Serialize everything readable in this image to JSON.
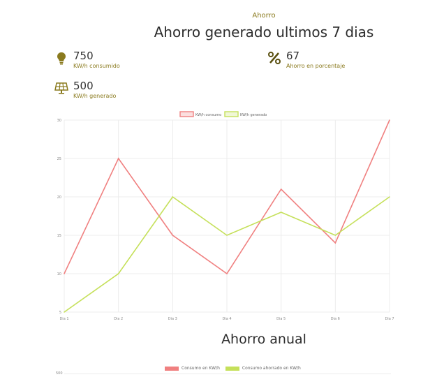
{
  "header": {
    "eyebrow": "Ahorro",
    "title": "Ahorro generado ultimos 7 dias"
  },
  "stats": {
    "consumed": {
      "value": "750",
      "label": "KW/h consumido",
      "icon": "lightbulb-icon"
    },
    "percent": {
      "value": "67",
      "label": "Ahorro en porcentaje",
      "icon": "percent-icon"
    },
    "generated": {
      "value": "500",
      "label": "KW/h generado",
      "icon": "solar-panel-icon"
    }
  },
  "colors": {
    "accent": "#8a7a1e",
    "consumo": "#f08080",
    "generado": "#c5e05a"
  },
  "chart_data": [
    {
      "type": "line",
      "categories": [
        "Dia 1",
        "Dia 2",
        "Dia 3",
        "Dia 4",
        "Dia 5",
        "Dia 6",
        "Dia 7"
      ],
      "series": [
        {
          "name": "KW/h consumo",
          "values": [
            10,
            25,
            15,
            10,
            21,
            14,
            30
          ],
          "color": "#f08080"
        },
        {
          "name": "KW/h generado",
          "values": [
            5,
            10,
            20,
            15,
            18,
            15,
            20
          ],
          "color": "#c5e05a"
        }
      ],
      "yticks": [
        5,
        10,
        15,
        20,
        25,
        30
      ],
      "ylim": [
        5,
        30
      ],
      "grid": true,
      "legend": "top"
    },
    {
      "type": "bar",
      "title": "Ahorro anual",
      "series": [
        {
          "name": "Consumo en KW/h",
          "color": "#f08080"
        },
        {
          "name": "Consumo ahorrado en KW/h",
          "color": "#c5e05a"
        }
      ],
      "ytick_visible": "500",
      "legend": "top"
    }
  ]
}
